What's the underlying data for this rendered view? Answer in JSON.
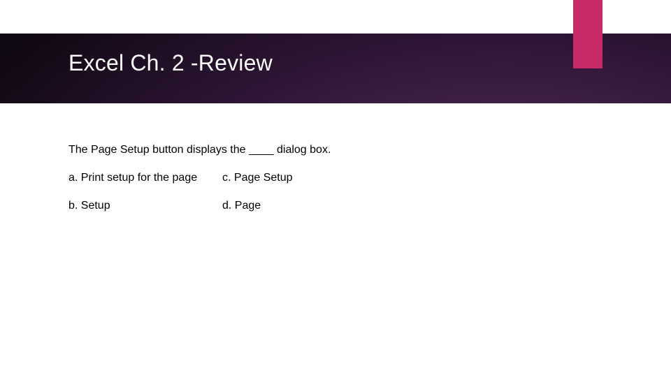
{
  "title": "Excel Ch. 2 -Review",
  "question": "The Page Setup button displays the ____ dialog box.",
  "options": {
    "a": "a. Print setup for the page",
    "b": "b. Setup",
    "c": "c. Page Setup",
    "d": "d. Page"
  },
  "accent_color": "#c72a66"
}
